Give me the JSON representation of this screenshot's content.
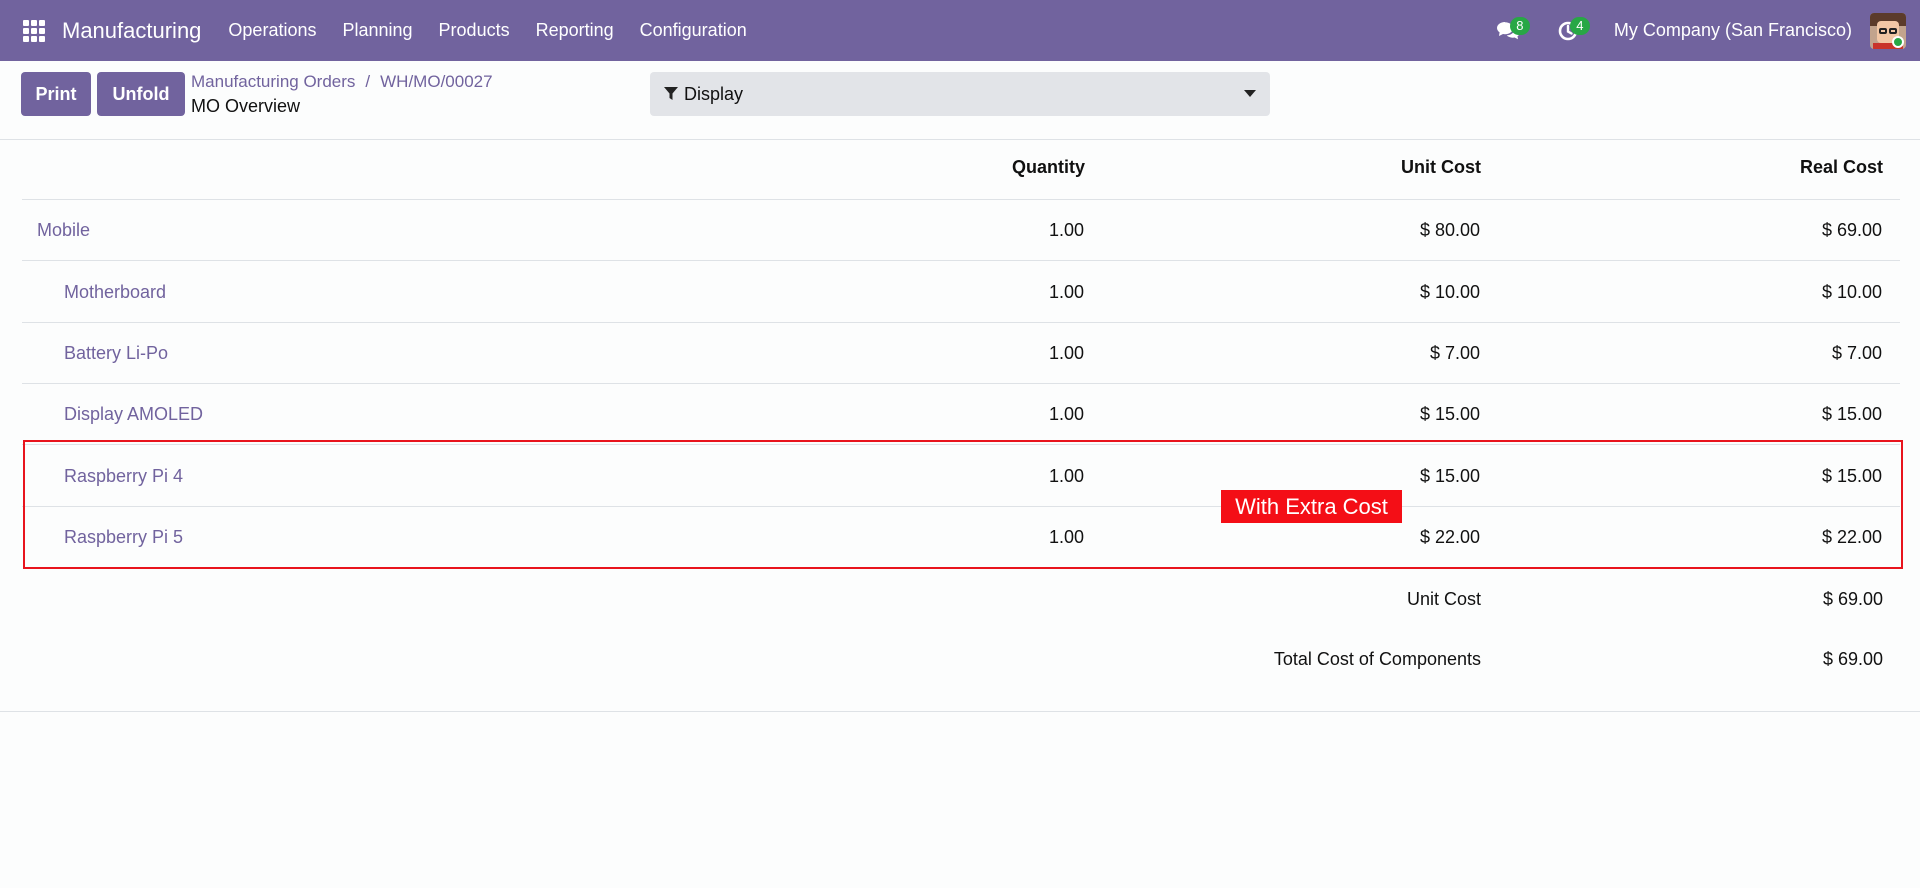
{
  "navbar": {
    "app_name": "Manufacturing",
    "menu": [
      "Operations",
      "Planning",
      "Products",
      "Reporting",
      "Configuration"
    ],
    "messages_count": "8",
    "activities_count": "4",
    "company": "My Company (San Francisco)",
    "color": "#71639e"
  },
  "control": {
    "print_label": "Print",
    "unfold_label": "Unfold",
    "breadcrumb_parent": "Manufacturing Orders",
    "breadcrumb_sep": "/",
    "breadcrumb_current": "WH/MO/00027",
    "page_title": "MO Overview",
    "display_label": "Display"
  },
  "table": {
    "headers": {
      "quantity": "Quantity",
      "unit_cost": "Unit Cost",
      "real_cost": "Real Cost"
    },
    "rows": [
      {
        "name": "Mobile",
        "qty": "1.00",
        "unit_cost": "$ 80.00",
        "real_cost": "$ 69.00"
      },
      {
        "name": "Motherboard",
        "qty": "1.00",
        "unit_cost": "$ 10.00",
        "real_cost": "$ 10.00"
      },
      {
        "name": "Battery Li-Po",
        "qty": "1.00",
        "unit_cost": "$ 7.00",
        "real_cost": "$ 7.00"
      },
      {
        "name": "Display AMOLED",
        "qty": "1.00",
        "unit_cost": "$ 15.00",
        "real_cost": "$ 15.00"
      },
      {
        "name": "Raspberry Pi 4",
        "qty": "1.00",
        "unit_cost": "$ 15.00",
        "real_cost": "$ 15.00"
      },
      {
        "name": "Raspberry Pi 5",
        "qty": "1.00",
        "unit_cost": "$ 22.00",
        "real_cost": "$ 22.00"
      }
    ],
    "summary": [
      {
        "label": "Unit Cost",
        "value": "$ 69.00"
      },
      {
        "label": "Total Cost of Components",
        "value": "$ 69.00"
      }
    ]
  },
  "annotation": {
    "text": "With Extra Cost",
    "color": "#f40e16"
  }
}
